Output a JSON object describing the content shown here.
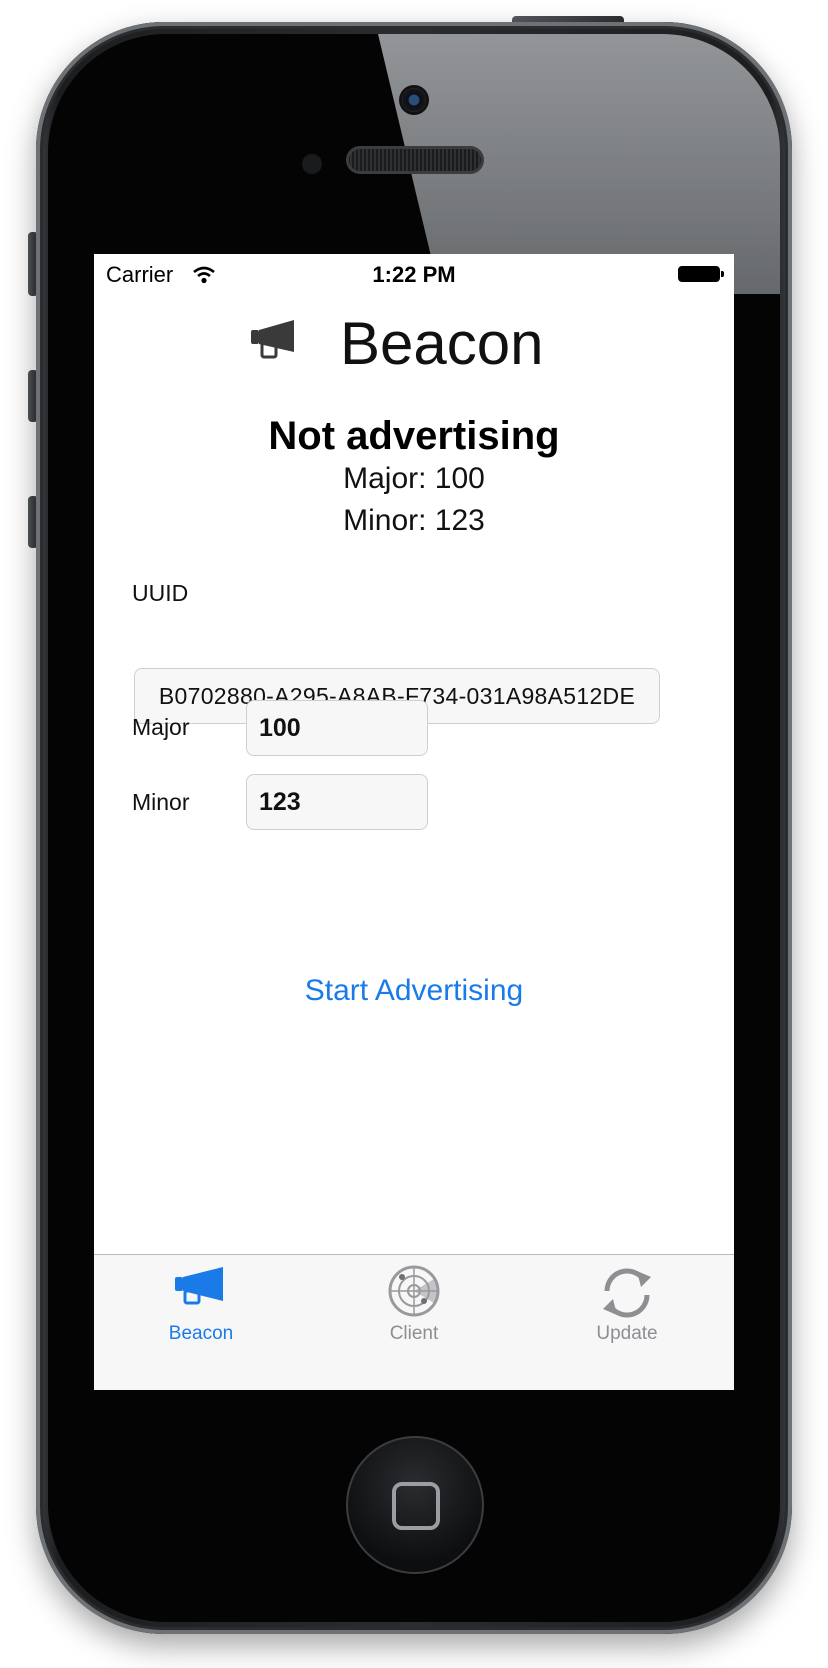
{
  "status_bar": {
    "carrier": "Carrier",
    "time": "1:22 PM"
  },
  "header": {
    "title": "Beacon",
    "icon": "megaphone-icon"
  },
  "beacon_status": {
    "title": "Not advertising",
    "major_line": "Major: 100",
    "minor_line": "Minor: 123"
  },
  "form": {
    "uuid_label": "UUID",
    "uuid_value": "B0702880-A295-A8AB-F734-031A98A512DE",
    "major_label": "Major",
    "major_value": "100",
    "minor_label": "Minor",
    "minor_value": "123"
  },
  "action": {
    "start_label": "Start Advertising"
  },
  "tab_bar": {
    "tabs": [
      {
        "label": "Beacon",
        "icon": "megaphone-icon",
        "active": true
      },
      {
        "label": "Client",
        "icon": "radar-icon",
        "active": false
      },
      {
        "label": "Update",
        "icon": "refresh-icon",
        "active": false
      }
    ]
  },
  "colors": {
    "accent": "#1a7be8",
    "inactive": "#8e8e93"
  }
}
